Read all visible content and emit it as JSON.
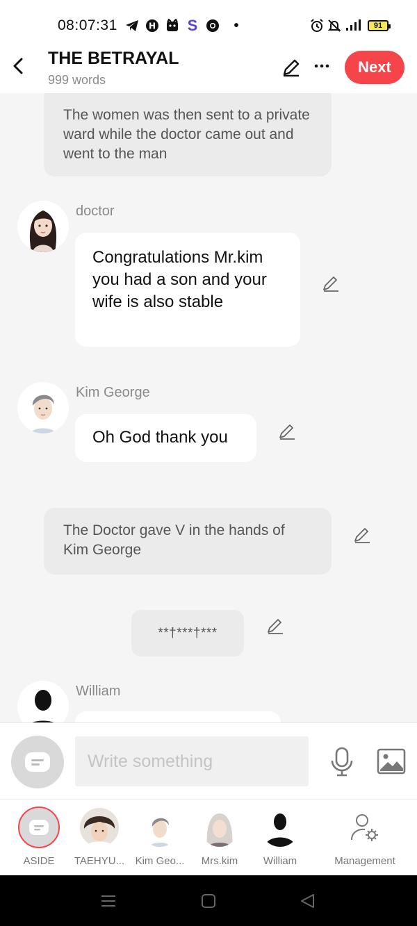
{
  "status_bar": {
    "time": "08:07:31",
    "battery": "91"
  },
  "header": {
    "title": "THE BETRAYAL",
    "word_count": "999 words",
    "next_label": "Next"
  },
  "messages": {
    "narration_1": "The women was then sent to a private ward while the doctor came out and went to the man",
    "doctor_name": "doctor",
    "doctor_text": "Congratulations Mr.kim you had a son and your wife is also stable",
    "george_name": "Kim George",
    "george_text": "Oh God thank you",
    "narration_2": "The Doctor gave V in the hands of Kim George",
    "separator": "**†***†***",
    "william_name": "William"
  },
  "input": {
    "placeholder": "Write something"
  },
  "characters": [
    {
      "label": "ASIDE"
    },
    {
      "label": "TAEHYU..."
    },
    {
      "label": "Kim Geo..."
    },
    {
      "label": "Mrs.kim"
    },
    {
      "label": "William"
    },
    {
      "label": "Management"
    }
  ],
  "colors": {
    "accent": "#f5454a",
    "background": "#f5f5f5",
    "narration_bg": "#ebebeb"
  }
}
